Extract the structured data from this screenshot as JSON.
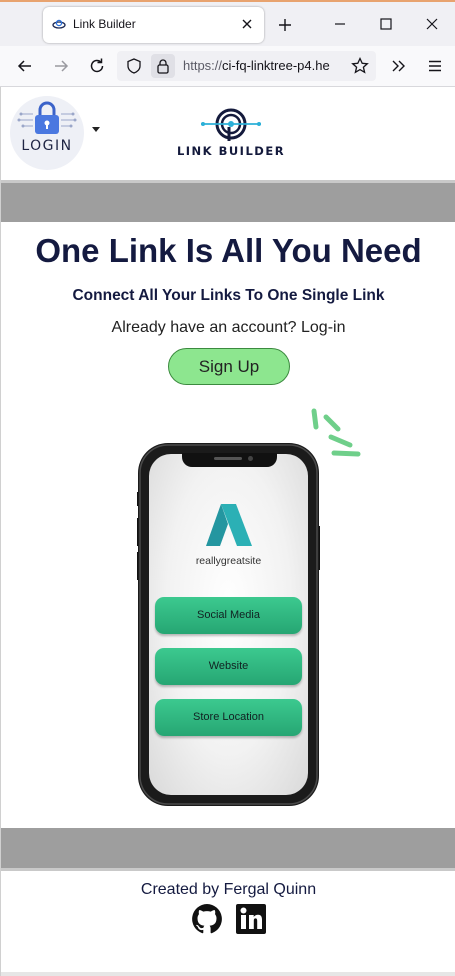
{
  "browser": {
    "tab_title": "Link Builder",
    "url_prefix": "https://",
    "url_host": "ci-fq-linktree-p4.he"
  },
  "header": {
    "login_label": "LOGIN",
    "brand_label": "LINK BUILDER"
  },
  "hero": {
    "title": "One Link Is All You Need",
    "subtitle": "Connect All Your Links To One Single Link",
    "login_prompt": "Already have an account? Log-in",
    "signup_label": "Sign Up"
  },
  "phone": {
    "site_name": "reallygreatsite",
    "links": [
      "Social Media",
      "Website",
      "Store Location"
    ]
  },
  "footer": {
    "credit": "Created by Fergal Quinn",
    "icons": [
      "github-icon",
      "linkedin-icon"
    ]
  },
  "colors": {
    "accent_green": "#8de68f",
    "link_green": "#2fb67e",
    "navy": "#141a40",
    "gray_bar": "#9e9e9e",
    "logo_teal": "#2bb0b5"
  }
}
